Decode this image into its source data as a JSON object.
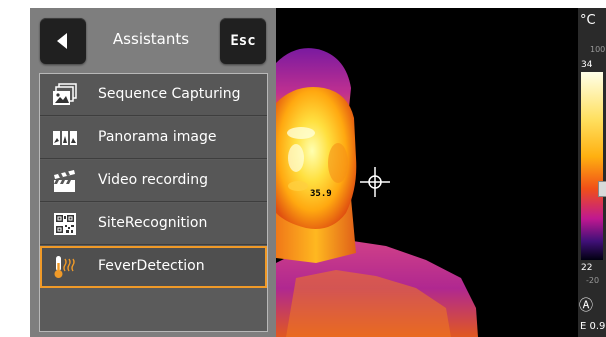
{
  "header": {
    "title": "Assistants",
    "esc_label": "Esc"
  },
  "menu": {
    "items": [
      {
        "label": "Sequence Capturing",
        "icon": "sequence-capture-icon"
      },
      {
        "label": "Panorama image",
        "icon": "panorama-icon"
      },
      {
        "label": "Video recording",
        "icon": "video-clapper-icon"
      },
      {
        "label": "SiteRecognition",
        "icon": "qr-code-icon"
      },
      {
        "label": "FeverDetection",
        "icon": "thermometer-icon",
        "selected": true
      }
    ]
  },
  "thermal": {
    "spot_temp": "35.9"
  },
  "scale": {
    "unit": "°C",
    "range_max": "100",
    "current_max": "34",
    "current_min": "22",
    "range_min": "-20",
    "auto_symbol": "Ⓐ",
    "emissivity": "E 0.9"
  },
  "colors": {
    "accent": "#f09a28",
    "panel": "#7e7e7e",
    "button": "#202020"
  }
}
